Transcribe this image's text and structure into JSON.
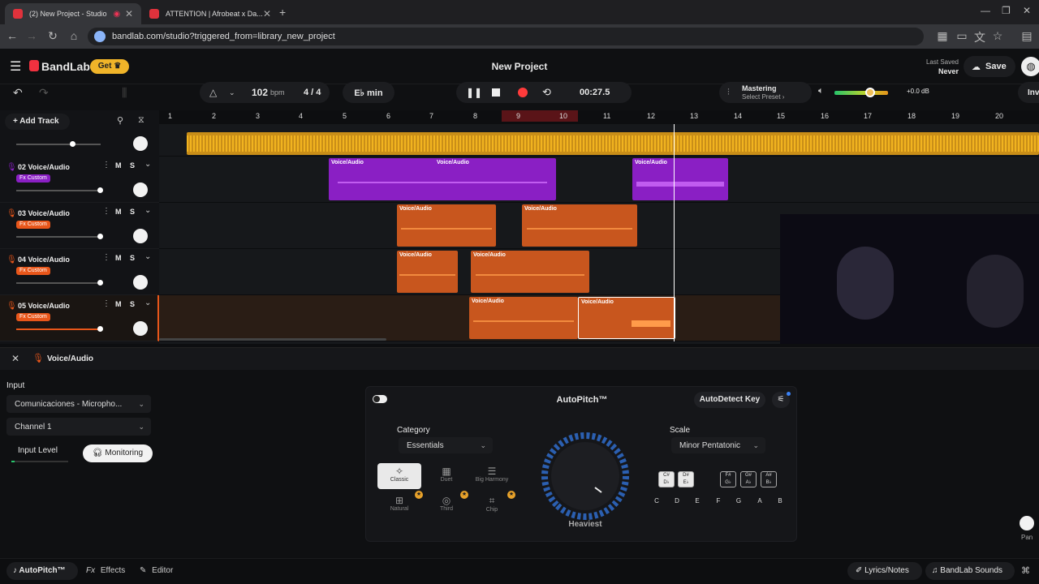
{
  "browser": {
    "tabs": [
      {
        "label": "(2) New Project - Studio"
      },
      {
        "label": "ATTENTION | Afrobeat x Da..."
      }
    ],
    "url": "bandlab.com/studio?triggered_from=library_new_project"
  },
  "header": {
    "logo": "BandLab",
    "get_label": "Get",
    "project_title": "New Project",
    "last_saved_label": "Last Saved",
    "last_saved_value": "Never",
    "save_label": "Save"
  },
  "toolbar": {
    "tempo": "102",
    "tempo_unit": "bpm",
    "time_signature": "4 / 4",
    "key": "E♭ min",
    "time": "00:27.5",
    "mastering_label": "Mastering",
    "mastering_sub": "Select Preset ›",
    "volume_db": "+0.0 dB",
    "cut_label": "Inv"
  },
  "tracks_header": {
    "add_track": "Add Track"
  },
  "tracks": [
    {
      "name": "02 Voice/Audio",
      "fx": "Fx Custom",
      "m": "M",
      "s": "S",
      "color": "#8a1fc4"
    },
    {
      "name": "03 Voice/Audio",
      "fx": "Fx Custom",
      "m": "M",
      "s": "S",
      "color": "#e8561a"
    },
    {
      "name": "04 Voice/Audio",
      "fx": "Fx Custom",
      "m": "M",
      "s": "S",
      "color": "#e8561a"
    },
    {
      "name": "05 Voice/Audio",
      "fx": "Fx Custom",
      "m": "M",
      "s": "S",
      "color": "#e8561a"
    }
  ],
  "ruler": [
    "1",
    "2",
    "3",
    "4",
    "5",
    "6",
    "7",
    "8",
    "9",
    "10",
    "11",
    "12",
    "13",
    "14",
    "15",
    "16",
    "17",
    "18",
    "19",
    "20"
  ],
  "clip_label": "Voice/Audio",
  "detail": {
    "track_label": "Voice/Audio",
    "input_label": "Input",
    "input_device": "Comunicaciones - Micropho...",
    "channel": "Channel 1",
    "input_level_label": "Input Level",
    "monitoring_label": "Monitoring"
  },
  "autopitch": {
    "title": "AutoPitch™",
    "autodetect_label": "AutoDetect Key",
    "category_label": "Category",
    "category_value": "Essentials",
    "presets": [
      "Classic",
      "Duet",
      "Big Harmony",
      "Natural",
      "Third",
      "Chip"
    ],
    "knob_label": "Heaviest",
    "scale_label": "Scale",
    "scale_value": "Minor Pentatonic",
    "sharp_keys": [
      {
        "top": "C#",
        "bottom": "D♭"
      },
      {
        "top": "D#",
        "bottom": "E♭"
      },
      {
        "top": "F#",
        "bottom": "G♭"
      },
      {
        "top": "G#",
        "bottom": "A♭"
      },
      {
        "top": "A#",
        "bottom": "B♭"
      }
    ],
    "notes": [
      "C",
      "D",
      "E",
      "F",
      "G",
      "A",
      "B"
    ]
  },
  "footer": {
    "autopitch_tab": "AutoPitch™",
    "effects_tab": "Effects",
    "editor_tab": "Editor",
    "lyrics_label": "Lyrics/Notes",
    "sounds_label": "BandLab Sounds",
    "pan_label": "Pan"
  },
  "colors": {
    "accent_orange": "#e8561a",
    "purple": "#8a1fc4",
    "yellow_track": "#e0a11c",
    "record_red": "#ff3b3b"
  }
}
